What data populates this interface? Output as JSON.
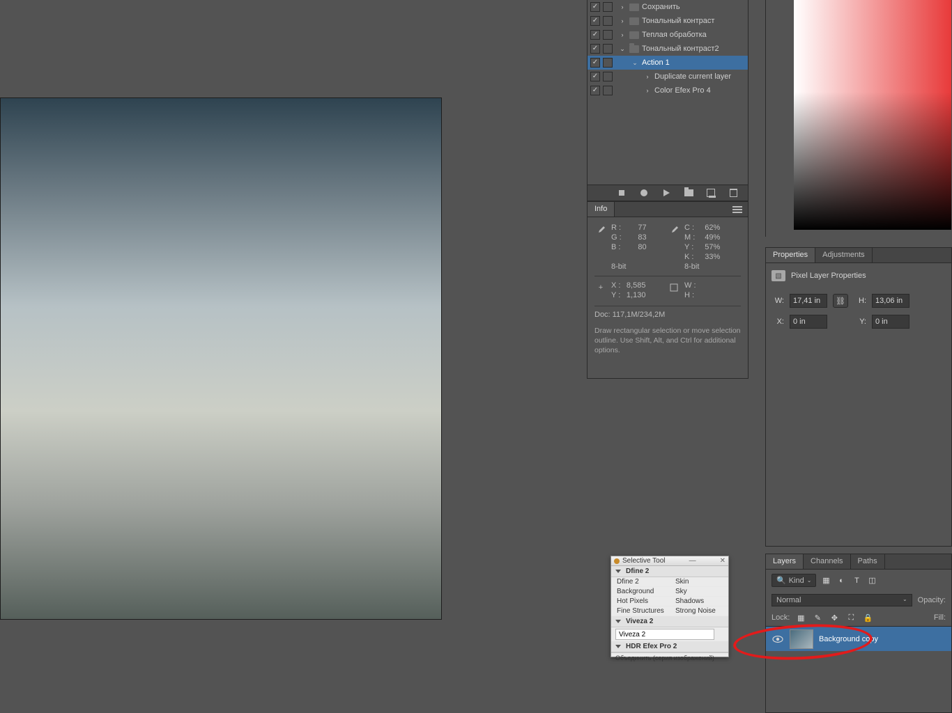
{
  "actions": {
    "items": [
      {
        "label": "Сохранить",
        "chev": ">",
        "folder": true,
        "indent": 0
      },
      {
        "label": "Тональный контраст",
        "chev": ">",
        "folder": true,
        "indent": 0
      },
      {
        "label": "Теплая обработка",
        "chev": ">",
        "folder": true,
        "indent": 0
      },
      {
        "label": "Тональный контраст2",
        "chev": "v",
        "folder": true,
        "open": true,
        "indent": 0
      },
      {
        "label": "Action 1",
        "chev": "v",
        "folder": false,
        "selected": true,
        "indent": 1
      },
      {
        "label": "Duplicate current layer",
        "chev": ">",
        "folder": false,
        "indent": 2
      },
      {
        "label": "Color Efex Pro 4",
        "chev": ">",
        "folder": false,
        "indent": 2
      }
    ]
  },
  "info": {
    "tab": "Info",
    "rgb": {
      "R": "77",
      "G": "83",
      "B": "80",
      "bit": "8-bit"
    },
    "cmyk": {
      "C": "62%",
      "M": "49%",
      "Y": "57%",
      "K": "33%",
      "bit": "8-bit"
    },
    "xy": {
      "X": "8,585",
      "Y": "1,130"
    },
    "wh": {
      "W": "",
      "H": ""
    },
    "doc": "Doc: 117,1M/234,2M",
    "hint": "Draw rectangular selection or move selection outline.  Use Shift, Alt, and Ctrl for additional options."
  },
  "properties": {
    "tabs": [
      "Properties",
      "Adjustments"
    ],
    "header": "Pixel Layer Properties",
    "W_lbl": "W:",
    "W": "17,41 in",
    "H_lbl": "H:",
    "H": "13,06 in",
    "X_lbl": "X:",
    "X": "0 in",
    "Y_lbl": "Y:",
    "Y": "0 in"
  },
  "layers": {
    "tabs": [
      "Layers",
      "Channels",
      "Paths"
    ],
    "kind_prefix": "🔍",
    "kind": "Kind",
    "blend": "Normal",
    "opacity_lbl": "Opacity:",
    "fill_lbl": "Fill:",
    "lock_lbl": "Lock:",
    "item": "Background copy"
  },
  "seltool": {
    "title": "Selective Tool",
    "dfine": "Dfine 2",
    "cols1": [
      "Dfine 2",
      "Background",
      "Hot Pixels",
      "Fine Structures"
    ],
    "cols2": [
      "Skin",
      "Sky",
      "Shadows",
      "Strong Noise"
    ],
    "viveza_hdr": "Viveza 2",
    "viveza": "Viveza 2",
    "hdr_hdr": "HDR Efex Pro 2",
    "ftr": "Объединить (серия изображений)"
  }
}
